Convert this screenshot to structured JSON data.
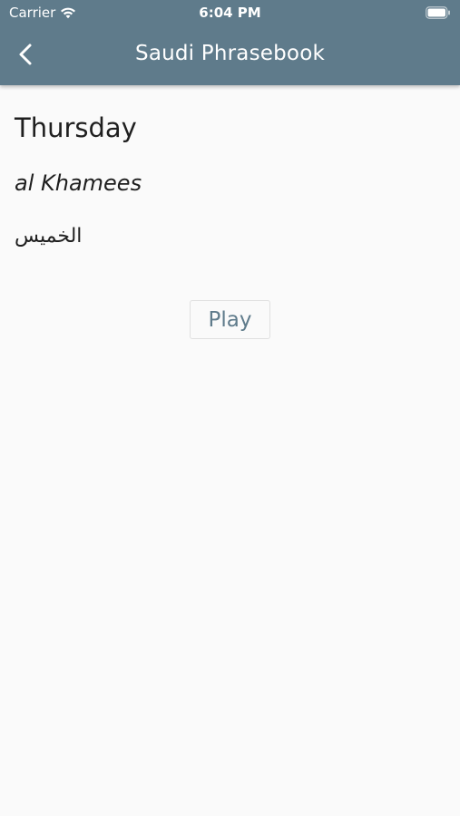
{
  "status_bar": {
    "carrier": "Carrier",
    "time": "6:04 PM"
  },
  "nav": {
    "title": "Saudi Phrasebook",
    "back_icon": "chevron-left-icon"
  },
  "phrase": {
    "english": "Thursday",
    "transliteration": "al Khamees",
    "arabic": "الخميس"
  },
  "actions": {
    "play_label": "Play"
  },
  "colors": {
    "header_bg": "#5f7b8b",
    "page_bg": "#fafafa",
    "accent": "#5f7b8b",
    "text": "#1f1f1f"
  }
}
